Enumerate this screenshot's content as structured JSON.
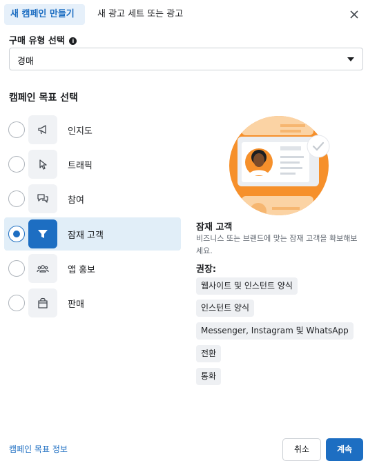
{
  "tabs": [
    {
      "label": "새 캠페인 만들기",
      "active": true
    },
    {
      "label": "새 광고 세트 또는 광고",
      "active": false
    }
  ],
  "purchase_type": {
    "label": "구매 유형 선택",
    "info_icon": "info-icon",
    "value": "경매"
  },
  "objective_section": {
    "label": "캠페인 목표 선택",
    "items": [
      {
        "label": "인지도",
        "icon": "megaphone-icon",
        "selected": false
      },
      {
        "label": "트래픽",
        "icon": "cursor-icon",
        "selected": false
      },
      {
        "label": "참여",
        "icon": "chat-bubble-icon",
        "selected": false
      },
      {
        "label": "잠재 고객",
        "icon": "funnel-icon",
        "selected": true
      },
      {
        "label": "앱 홍보",
        "icon": "people-icon",
        "selected": false
      },
      {
        "label": "판매",
        "icon": "shopping-bag-icon",
        "selected": false
      }
    ]
  },
  "detail": {
    "title": "잠재 고객",
    "description": "비즈니스 또는 브랜드에 맞는 잠재 고객을 확보해보세요.",
    "recommended_label": "권장:",
    "recommended": [
      "웹사이트 및 인스턴트 양식",
      "인스턴트 양식",
      "Messenger, Instagram 및 WhatsApp",
      "전환",
      "통화"
    ]
  },
  "footer": {
    "link": "캠페인 목표 정보",
    "cancel": "취소",
    "continue": "계속"
  },
  "colors": {
    "accent": "#1d6ec2",
    "illustration_orange": "#f6902b"
  }
}
